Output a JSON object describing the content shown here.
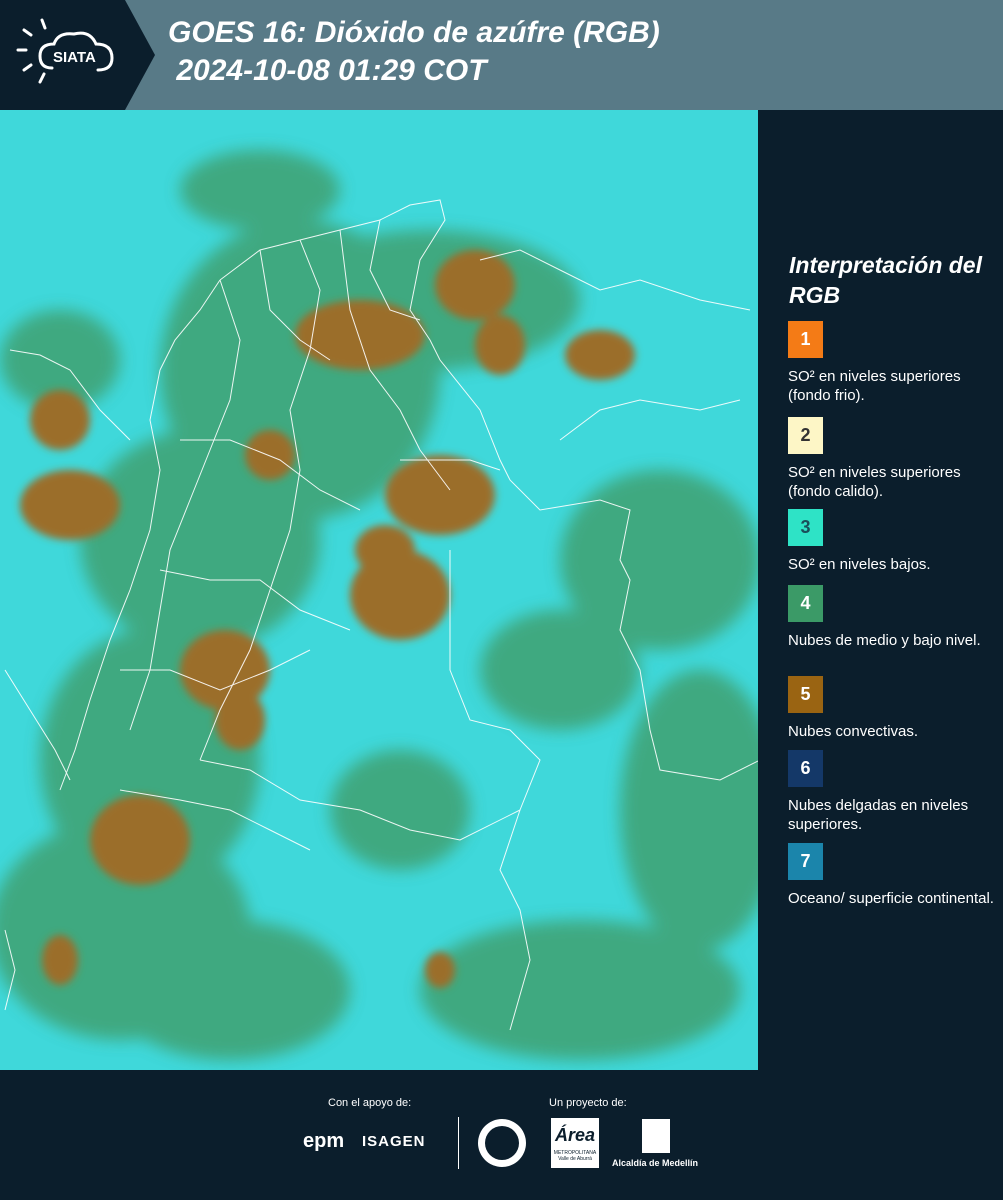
{
  "header": {
    "brand": "SIATA",
    "title": "GOES 16: Dióxido de azúfre (RGB)\n 2024-10-08 01:29 COT"
  },
  "legend": {
    "title": "Interpretación del RGB",
    "items": [
      {
        "num": "1",
        "color": "#f47b16",
        "text": "SO² en niveles superiores (fondo frio)."
      },
      {
        "num": "2",
        "color": "#fdf6c6",
        "text": "SO² en niveles superiores (fondo calido)."
      },
      {
        "num": "3",
        "color": "#2ee3c6",
        "text": "SO² en niveles bajos."
      },
      {
        "num": "4",
        "color": "#3b9a67",
        "text": "Nubes de medio y bajo nivel."
      },
      {
        "num": "5",
        "color": "#9a6412",
        "text": "Nubes convectivas."
      },
      {
        "num": "6",
        "color": "#143868",
        "text": "Nubes delgadas en niveles superiores."
      },
      {
        "num": "7",
        "color": "#1b85ab",
        "text": "Oceano/ superficie continental."
      }
    ]
  },
  "footer": {
    "support_label": "Con el apoyo de:",
    "project_label": "Un proyecto de:",
    "sponsor1": "epm",
    "sponsor2": "ISAGEN",
    "partner1": "Área",
    "partner1_sub": "METROPOLITANA Valle de Aburrá",
    "partner2": "Alcaldía de Medellín"
  }
}
